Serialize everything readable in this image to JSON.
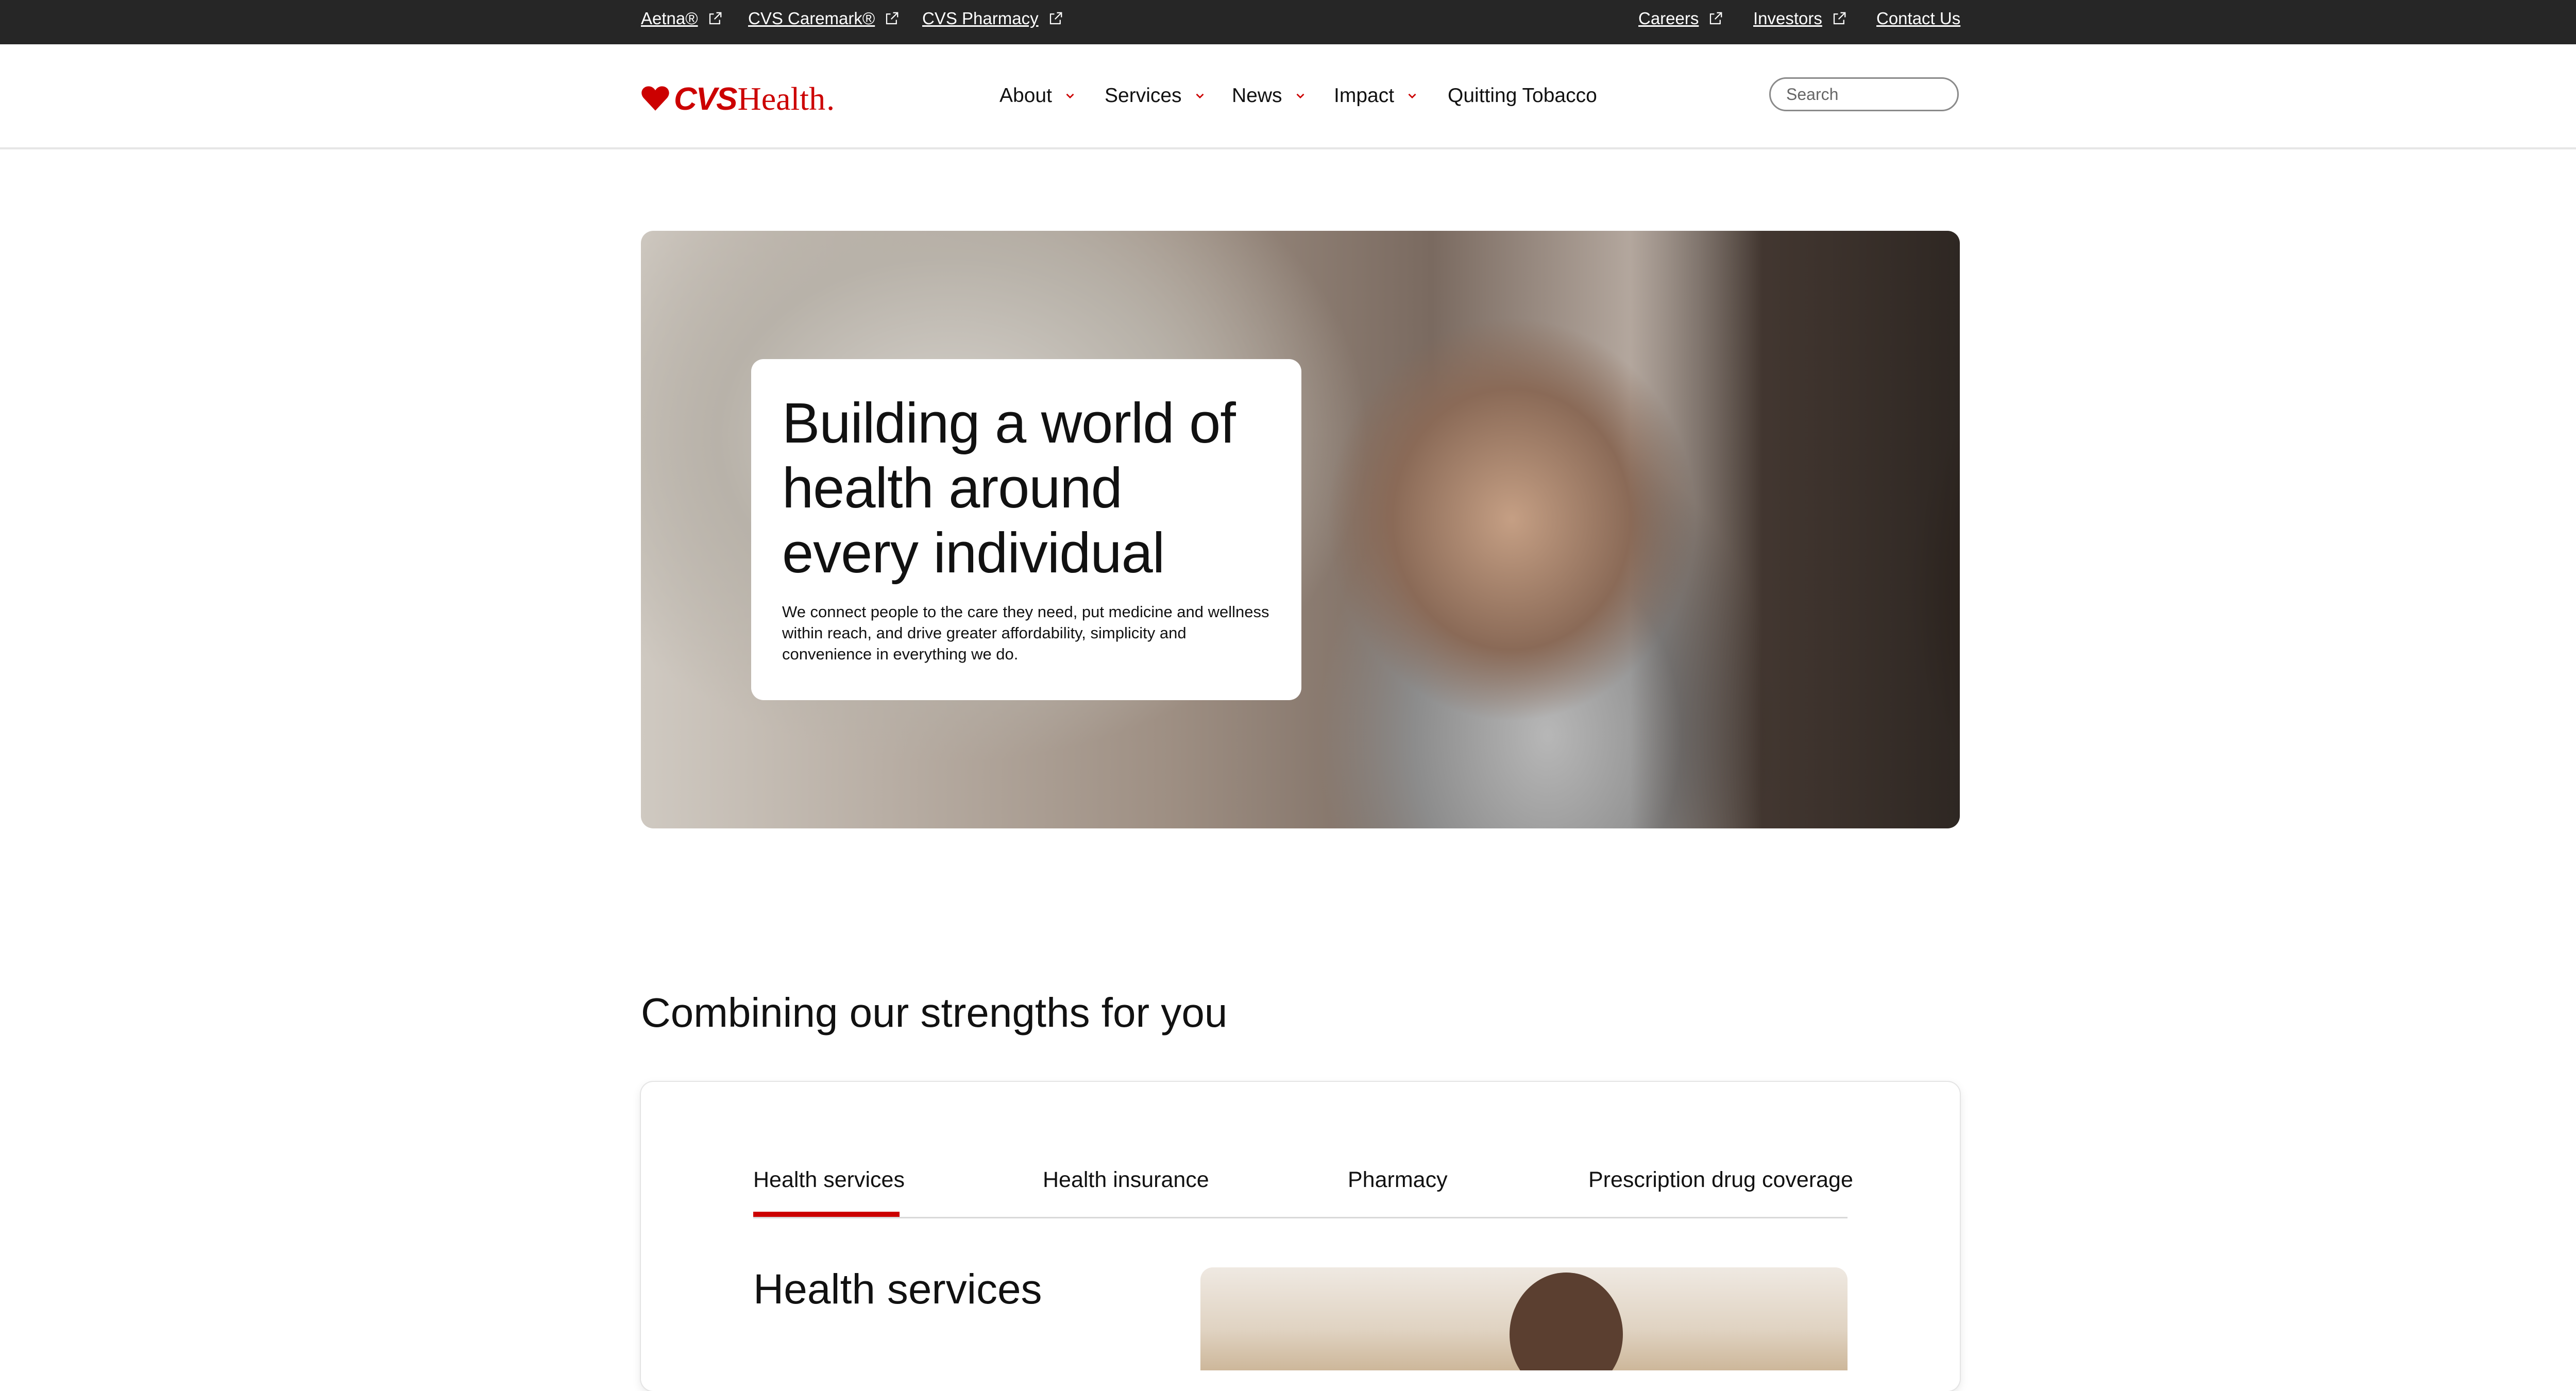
{
  "utility_bar": {
    "left_links": [
      {
        "label": "Aetna®"
      },
      {
        "label": "CVS Caremark®"
      },
      {
        "label": "CVS Pharmacy"
      }
    ],
    "right_links": [
      {
        "label": "Careers"
      },
      {
        "label": "Investors"
      },
      {
        "label": "Contact Us"
      }
    ]
  },
  "header": {
    "logo": {
      "part1": "CVS",
      "part2": "Health",
      "suffix": ".",
      "icon": "heart-icon"
    },
    "nav": [
      {
        "label": "About",
        "has_dropdown": true
      },
      {
        "label": "Services",
        "has_dropdown": true
      },
      {
        "label": "News",
        "has_dropdown": true
      },
      {
        "label": "Impact",
        "has_dropdown": true
      },
      {
        "label": "Quitting Tobacco",
        "has_dropdown": false
      }
    ],
    "search": {
      "placeholder": "Search",
      "value": "",
      "icon": "search-icon"
    }
  },
  "hero": {
    "title": "Building a world of health around every individual",
    "text": "We connect people to the care they need, put medicine and wellness within reach, and drive greater affordability, simplicity and convenience in everything we do."
  },
  "strengths": {
    "title": "Combining our strengths for you",
    "tabs": [
      {
        "label": "Health services",
        "active": true
      },
      {
        "label": "Health insurance",
        "active": false
      },
      {
        "label": "Pharmacy",
        "active": false
      },
      {
        "label": "Prescription drug coverage",
        "active": false
      }
    ],
    "active_content": {
      "title": "Health services"
    }
  },
  "colors": {
    "brand_red": "#cc0000",
    "utility_bar_bg": "#262626",
    "text": "#111111"
  }
}
